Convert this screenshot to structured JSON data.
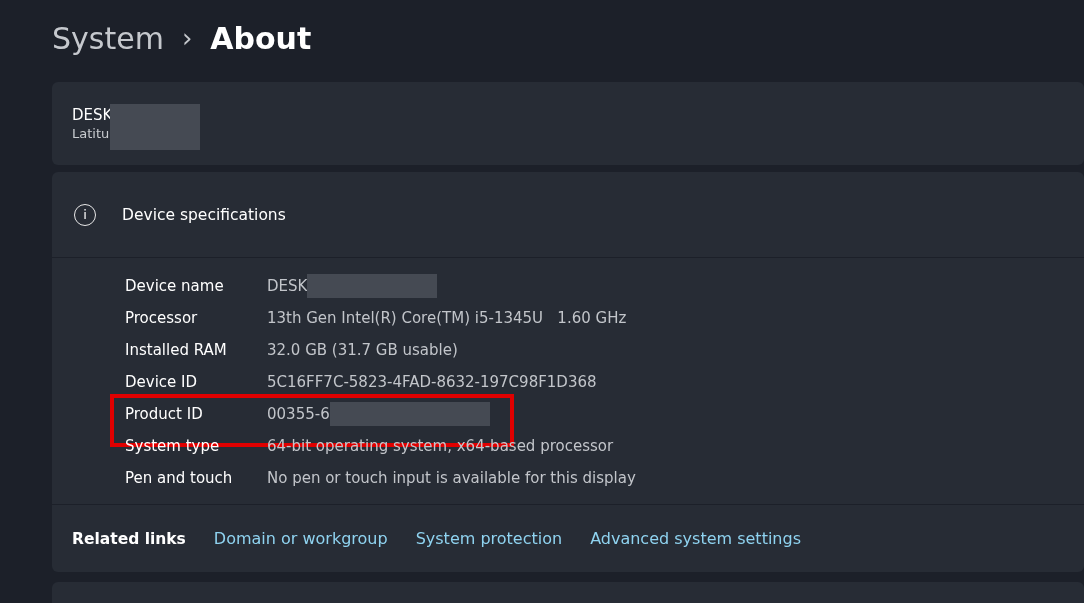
{
  "breadcrumb": {
    "parent": "System",
    "separator": "›",
    "current": "About"
  },
  "device_card": {
    "name": "DESK",
    "model": "Latitu"
  },
  "specs": {
    "title": "Device specifications",
    "info_icon": "i",
    "rows": [
      {
        "label": "Device name",
        "value": "DESK",
        "redacted": true
      },
      {
        "label": "Processor",
        "value": "13th Gen Intel(R) Core(TM) i5-1345U   1.60 GHz",
        "redacted": false
      },
      {
        "label": "Installed RAM",
        "value": "32.0 GB (31.7 GB usable)",
        "redacted": false
      },
      {
        "label": "Device ID",
        "value": "5C16FF7C-5823-4FAD-8632-197C98F1D368",
        "redacted": false
      },
      {
        "label": "Product ID",
        "value": "00355-6",
        "redacted": true,
        "highlighted": true
      },
      {
        "label": "System type",
        "value": "64-bit operating system, x64-based processor",
        "redacted": false
      },
      {
        "label": "Pen and touch",
        "value": "No pen or touch input is available for this display",
        "redacted": false
      }
    ]
  },
  "related_links": {
    "label": "Related links",
    "links": [
      "Domain or workgroup",
      "System protection",
      "Advanced system settings"
    ]
  }
}
